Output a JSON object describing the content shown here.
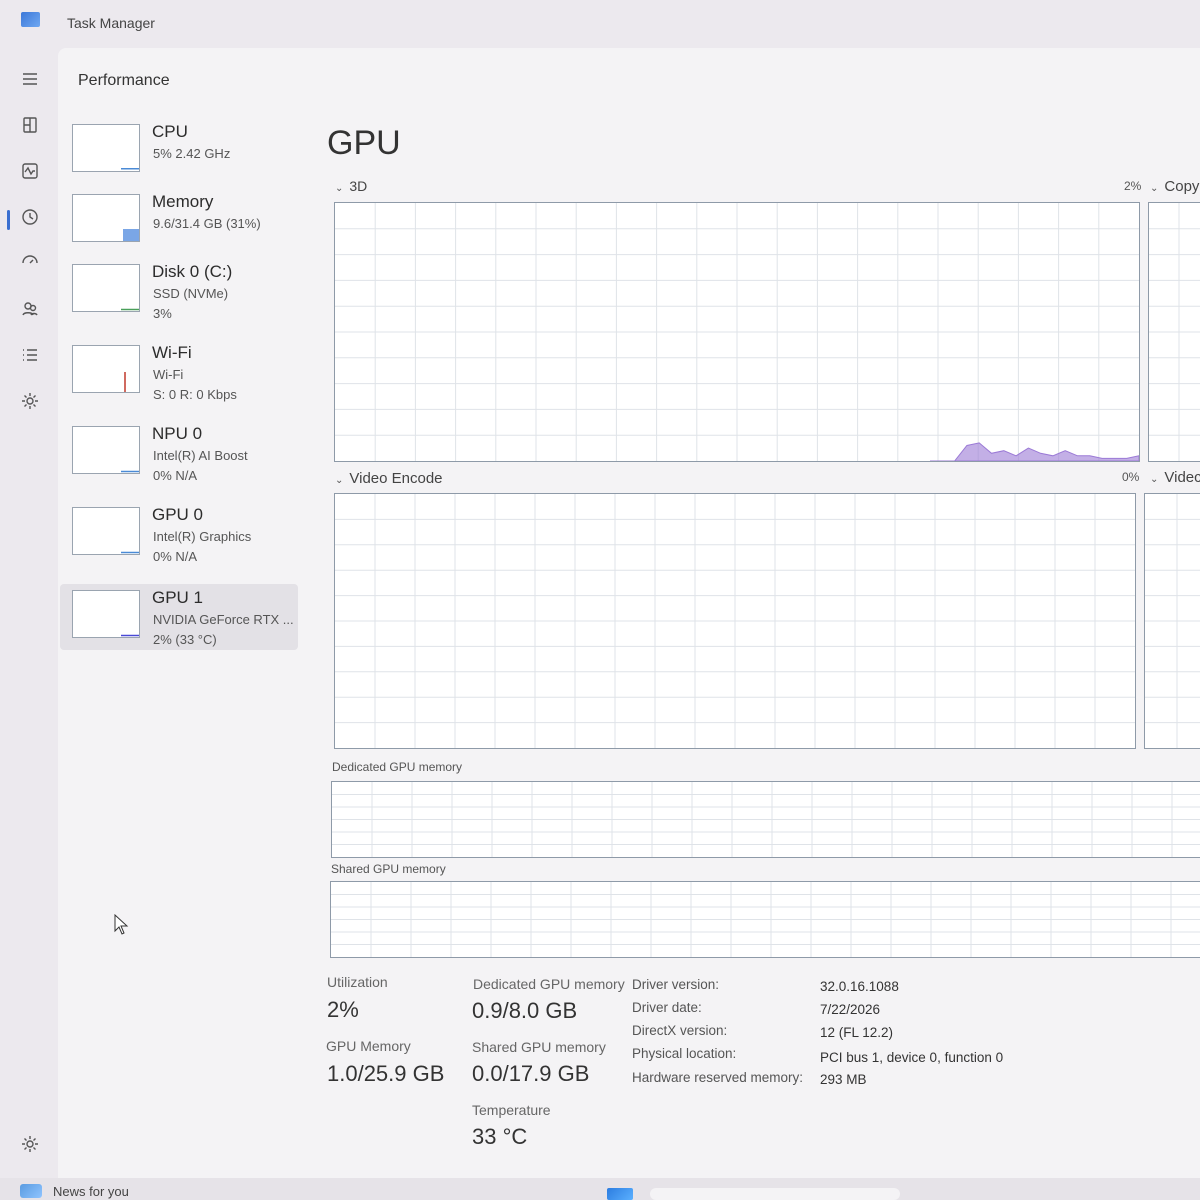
{
  "window": {
    "title": "Task Manager"
  },
  "header": {
    "title": "Performance"
  },
  "rail": {
    "icons": [
      "hamburger-menu-icon",
      "processes-icon",
      "performance-icon",
      "app-history-icon",
      "startup-apps-icon",
      "users-icon",
      "details-icon",
      "services-icon",
      "settings-icon"
    ],
    "active": "performance-icon"
  },
  "sidebar": {
    "items": [
      {
        "name": "CPU",
        "sub1": "5% 2.42 GHz",
        "sub2": "",
        "load": 5,
        "color": "#4a8ad6"
      },
      {
        "name": "Memory",
        "sub1": "9.6/31.4 GB (31%)",
        "sub2": "",
        "load": 31,
        "color": "#8a5cc9"
      },
      {
        "name": "Disk 0 (C:)",
        "sub1": "SSD (NVMe)",
        "sub2": "3%",
        "load": 3,
        "color": "#4aa05a"
      },
      {
        "name": "Wi-Fi",
        "sub1": "Wi-Fi",
        "sub2": "S: 0 R: 0 Kbps",
        "load": 0,
        "color": "#c0392b"
      },
      {
        "name": "NPU 0",
        "sub1": "Intel(R) AI Boost",
        "sub2": "0% N/A",
        "load": 0,
        "color": "#4a8ad6"
      },
      {
        "name": "GPU 0",
        "sub1": "Intel(R) Graphics",
        "sub2": "0% N/A",
        "load": 0,
        "color": "#4a8ad6"
      },
      {
        "name": "GPU 1",
        "sub1": "NVIDIA GeForce RTX ...",
        "sub2": "2% (33 °C)",
        "load": 2,
        "color": "#4a4ad6"
      }
    ],
    "selected_index": 6
  },
  "main": {
    "title": "GPU",
    "engines": [
      {
        "label": "3D",
        "percent": "2%"
      },
      {
        "label": "Copy",
        "percent": ""
      },
      {
        "label": "Video Encode",
        "percent": "0%"
      },
      {
        "label": "Videc",
        "percent": ""
      }
    ],
    "dedicated_label": "Dedicated GPU memory",
    "shared_label": "Shared GPU memory",
    "graph_color": "#9b7ad6",
    "activity_3d": [
      0,
      0,
      0,
      6,
      7,
      3,
      4,
      2,
      5,
      3,
      2,
      4,
      2,
      2,
      1,
      1,
      1,
      2
    ]
  },
  "stats": {
    "utilization": {
      "label": "Utilization",
      "value": "2%"
    },
    "gpu_memory": {
      "label": "GPU Memory",
      "value": "1.0/25.9 GB"
    },
    "dedicated": {
      "label": "Dedicated GPU memory",
      "value": "0.9/8.0 GB"
    },
    "shared": {
      "label": "Shared GPU memory",
      "value": "0.0/17.9 GB"
    },
    "temperature": {
      "label": "Temperature",
      "value": "33 °C"
    }
  },
  "details": [
    {
      "key": "Driver version:",
      "value": "32.0.16.1088"
    },
    {
      "key": "Driver date:",
      "value": "7/22/2026"
    },
    {
      "key": "DirectX version:",
      "value": "12 (FL 12.2)"
    },
    {
      "key": "Physical location:",
      "value": "PCI bus 1, device 0, function 0"
    },
    {
      "key": "Hardware reserved memory:",
      "value": "293 MB"
    }
  ],
  "taskbar": {
    "news": "News for you"
  }
}
